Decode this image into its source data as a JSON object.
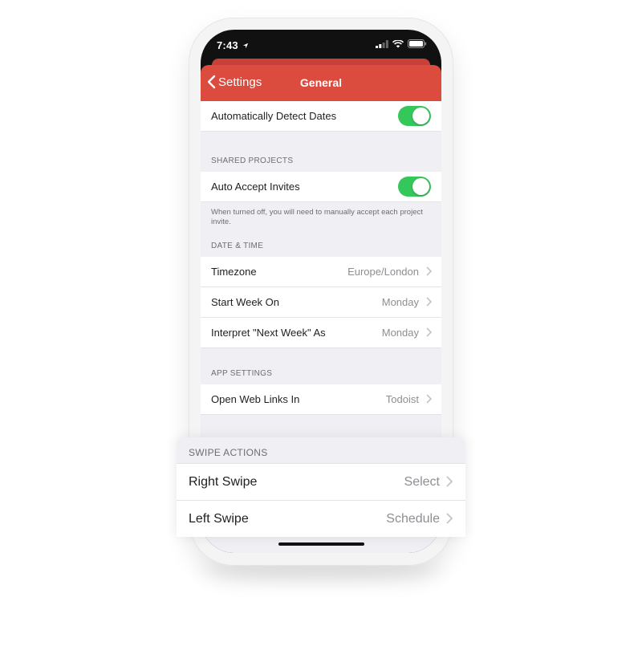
{
  "status_bar": {
    "time": "7:43"
  },
  "navbar": {
    "back_label": "Settings",
    "title": "General"
  },
  "rows": {
    "auto_detect": {
      "label": "Automatically Detect Dates",
      "enabled": true
    },
    "auto_accept": {
      "label": "Auto Accept Invites",
      "enabled": true
    },
    "timezone": {
      "label": "Timezone",
      "value": "Europe/London"
    },
    "start_week": {
      "label": "Start Week On",
      "value": "Monday"
    },
    "next_week": {
      "label": "Interpret \"Next Week\" As",
      "value": "Monday"
    },
    "web_links": {
      "label": "Open Web Links In",
      "value": "Todoist"
    }
  },
  "sections": {
    "shared_projects": "SHARED PROJECTS",
    "shared_footer": "When turned off, you will need to manually accept each project invite.",
    "date_time": "DATE & TIME",
    "app_settings": "APP SETTINGS"
  },
  "overlay": {
    "header": "SWIPE ACTIONS",
    "right_swipe": {
      "label": "Right Swipe",
      "value": "Select"
    },
    "left_swipe": {
      "label": "Left Swipe",
      "value": "Schedule"
    }
  },
  "colors": {
    "brand_red": "#db4c3f",
    "toggle_on": "#34c759",
    "group_background": "#efeff4",
    "secondary_text": "#8e8e93"
  },
  "icons": [
    "back-chevron-icon",
    "location-arrow-icon",
    "signal-icon",
    "wifi-icon",
    "battery-icon",
    "chevron-right-icon"
  ]
}
